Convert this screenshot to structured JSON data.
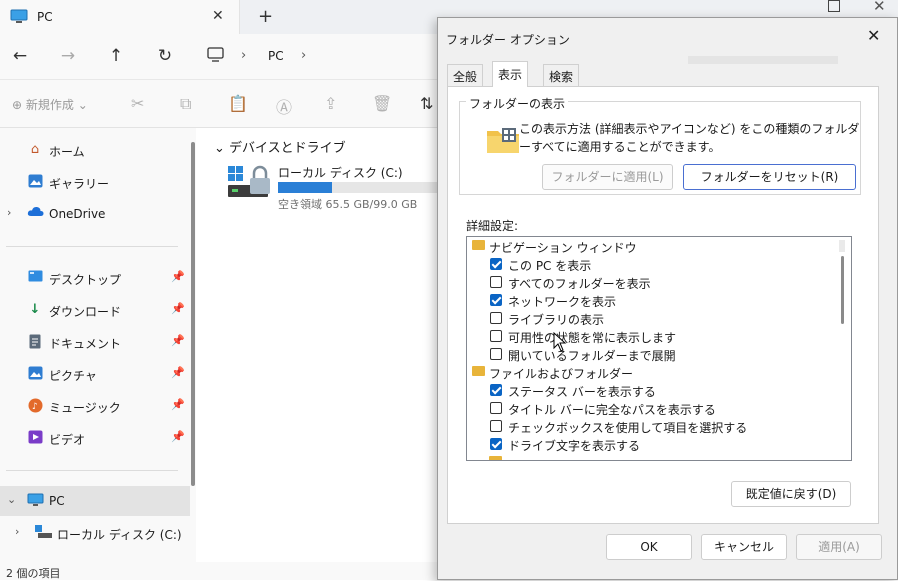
{
  "explorer": {
    "tab_title": "PC",
    "tab_close_icon": "close-icon",
    "new_tab_icon": "plus-icon",
    "breadcrumb": [
      "PC"
    ],
    "new_item_label": "新規作成",
    "sidebar": {
      "quick": [
        {
          "label": "ホーム",
          "icon": "home-icon"
        },
        {
          "label": "ギャラリー",
          "icon": "gallery-icon"
        },
        {
          "label": "OneDrive",
          "icon": "cloud-icon"
        }
      ],
      "pinned": [
        {
          "label": "デスクトップ",
          "icon": "desktop-icon"
        },
        {
          "label": "ダウンロード",
          "icon": "download-icon"
        },
        {
          "label": "ドキュメント",
          "icon": "document-icon"
        },
        {
          "label": "ピクチャ",
          "icon": "picture-icon"
        },
        {
          "label": "ミュージック",
          "icon": "music-icon"
        },
        {
          "label": "ビデオ",
          "icon": "video-icon"
        }
      ],
      "pc": {
        "label": "PC",
        "icon": "pc-icon"
      },
      "local_disk": {
        "label": "ローカル ディスク (C:)",
        "icon": "drive-icon"
      }
    },
    "section_title": "デバイスとドライブ",
    "drive": {
      "name": "ローカル ディスク (C:)",
      "free_text": "空き領域 65.5 GB/99.0 GB",
      "used_fraction": 0.34
    },
    "status_text": "2 個の項目"
  },
  "dialog": {
    "title": "フォルダー オプション",
    "tabs": [
      "全般",
      "表示",
      "検索"
    ],
    "active_tab": "表示",
    "folder_view_group": "フォルダーの表示",
    "folder_view_desc": "この表示方法 (詳細表示やアイコンなど) をこの種類のフォルダーすべてに適用することができます。",
    "apply_to_folders": "フォルダーに適用(L)",
    "reset_folders": "フォルダーをリセット(R)",
    "advanced_label": "詳細設定:",
    "tree": [
      {
        "type": "group",
        "label": "ナビゲーション ウィンドウ"
      },
      {
        "type": "check",
        "label": "この PC を表示",
        "checked": true
      },
      {
        "type": "check",
        "label": "すべてのフォルダーを表示",
        "checked": false
      },
      {
        "type": "check",
        "label": "ネットワークを表示",
        "checked": true
      },
      {
        "type": "check",
        "label": "ライブラリの表示",
        "checked": false
      },
      {
        "type": "check",
        "label": "可用性の状態を常に表示します",
        "checked": false
      },
      {
        "type": "check",
        "label": "開いているフォルダーまで展開",
        "checked": false
      },
      {
        "type": "group",
        "label": "ファイルおよびフォルダー"
      },
      {
        "type": "check",
        "label": "ステータス バーを表示する",
        "checked": true
      },
      {
        "type": "check",
        "label": "タイトル バーに完全なパスを表示する",
        "checked": false
      },
      {
        "type": "check",
        "label": "チェックボックスを使用して項目を選択する",
        "checked": false
      },
      {
        "type": "check",
        "label": "ドライブ文字を表示する",
        "checked": true
      }
    ],
    "restore_defaults": "既定値に戻す(D)",
    "ok": "OK",
    "cancel": "キャンセル",
    "apply": "適用(A)"
  },
  "colors": {
    "accent": "#0a64c4",
    "drive_bar": "#2a7fd6"
  }
}
